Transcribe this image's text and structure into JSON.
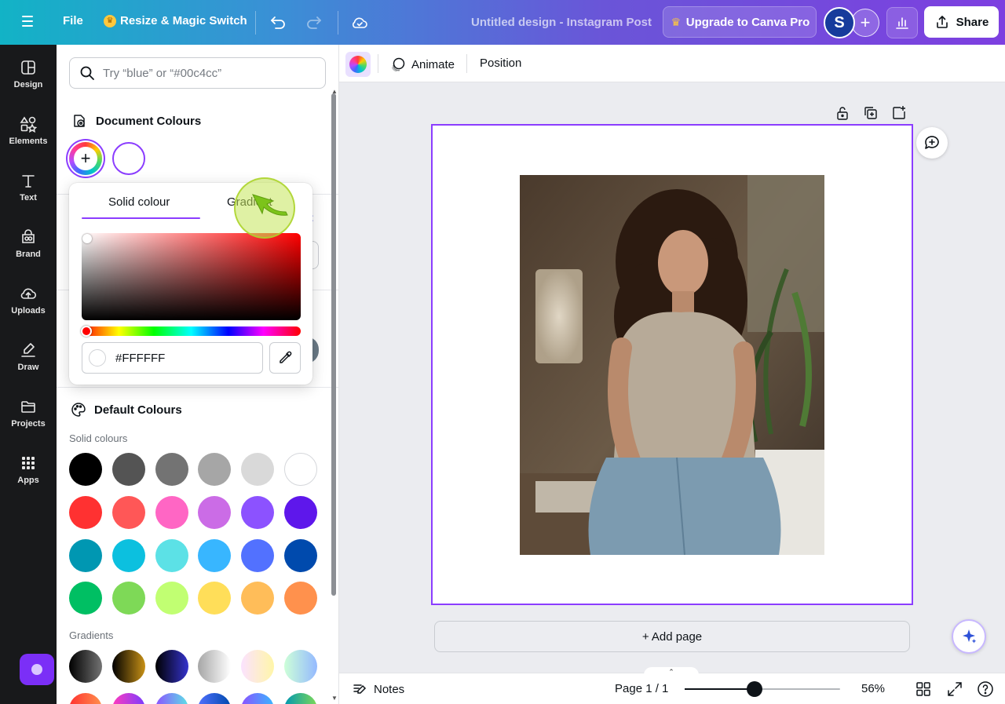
{
  "topbar": {
    "file_label": "File",
    "resize_label": "Resize & Magic Switch",
    "doc_title": "Untitled design - Instagram Post",
    "upgrade_label": "Upgrade to Canva Pro",
    "avatar_initial": "S",
    "share_label": "Share"
  },
  "rail": {
    "items": [
      {
        "label": "Design",
        "icon": "design-icon"
      },
      {
        "label": "Elements",
        "icon": "elements-icon"
      },
      {
        "label": "Text",
        "icon": "text-icon"
      },
      {
        "label": "Brand",
        "icon": "brand-icon"
      },
      {
        "label": "Uploads",
        "icon": "uploads-icon"
      },
      {
        "label": "Draw",
        "icon": "draw-icon"
      },
      {
        "label": "Projects",
        "icon": "projects-icon"
      },
      {
        "label": "Apps",
        "icon": "apps-icon"
      }
    ]
  },
  "panel": {
    "search_placeholder": "Try “blue” or “#00c4cc”",
    "document_colours_title": "Document Colours",
    "default_colours_title": "Default Colours",
    "solid_label": "Solid colours",
    "gradients_label": "Gradients",
    "behind_link_fragment": "t",
    "solid_colours": [
      "#000000",
      "#545454",
      "#737373",
      "#a6a6a6",
      "#d9d9d9",
      "#ffffff",
      "#ff3131",
      "#ff5757",
      "#ff66c4",
      "#cb6ce6",
      "#8c52ff",
      "#5e17eb",
      "#0097b2",
      "#0cc0df",
      "#5ce1e6",
      "#38b6ff",
      "#5271ff",
      "#004aad",
      "#00bf63",
      "#7ed957",
      "#c1ff72",
      "#ffde59",
      "#ffbd59",
      "#ff914d"
    ],
    "gradients": [
      [
        "#000000",
        "#737373"
      ],
      [
        "#000000",
        "#c89116"
      ],
      [
        "#000000",
        "#3533cd"
      ],
      [
        "#a6a6a6",
        "#ffffff"
      ],
      [
        "#fbe2ff",
        "#fff6a8"
      ],
      [
        "#cdffd8",
        "#94b9ff"
      ]
    ],
    "gradients_row2": [
      [
        "#ff3131",
        "#ff914d"
      ],
      [
        "#ff3bbd",
        "#7a3cff"
      ],
      [
        "#8c52ff",
        "#5ce1e6"
      ],
      [
        "#5170ff",
        "#004aad"
      ],
      [
        "#8c52ff",
        "#38b6ff"
      ],
      [
        "#0097b2",
        "#7ed957"
      ]
    ]
  },
  "picker": {
    "tab_solid": "Solid colour",
    "tab_gradient": "Gradient",
    "hex_value": "#FFFFFF",
    "hue_degrees": 0,
    "saturation": 0,
    "brightness": 1
  },
  "context_bar": {
    "animate_label": "Animate",
    "position_label": "Position"
  },
  "canvas": {
    "add_page_label": "+ Add page"
  },
  "footer": {
    "notes_label": "Notes",
    "page_label": "Page 1 / 1",
    "zoom_label": "56%",
    "zoom_fraction": 0.45
  },
  "colors": {
    "accent": "#8b3dff",
    "rail_bg": "#18191b"
  }
}
